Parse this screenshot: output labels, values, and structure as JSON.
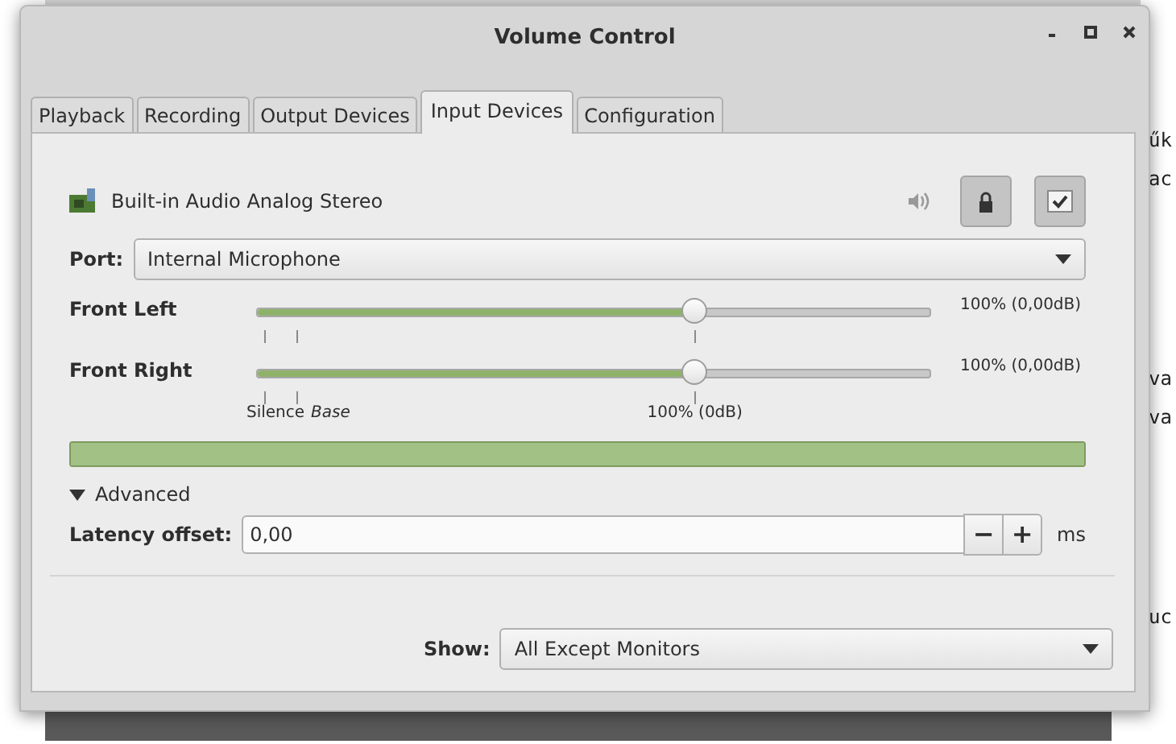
{
  "background_terminal": {
    "fragments": [
      "űk",
      "ac",
      "va",
      "va",
      "uc"
    ]
  },
  "window": {
    "title": "Volume Control"
  },
  "tabs": [
    {
      "label": "Playback",
      "selected": false
    },
    {
      "label": "Recording",
      "selected": false
    },
    {
      "label": "Output Devices",
      "selected": false
    },
    {
      "label": "Input Devices",
      "selected": true
    },
    {
      "label": "Configuration",
      "selected": false
    }
  ],
  "device": {
    "name": "Built-in Audio Analog Stereo",
    "lock": {
      "selected": true
    },
    "default": {
      "selected": true
    },
    "port": {
      "label": "Port:",
      "value": "Internal Microphone"
    },
    "channels": [
      {
        "name": "Front Left",
        "level": 0.65,
        "reading": "100% (0,00dB)"
      },
      {
        "name": "Front Right",
        "level": 0.65,
        "reading": "100% (0,00dB)"
      }
    ],
    "scale_marks": [
      {
        "label": "Silence",
        "italic": false
      },
      {
        "label": "Base",
        "italic": true
      },
      {
        "label": "100% (0dB)",
        "italic": false
      }
    ],
    "peak_meter": {
      "level": 1
    },
    "advanced": {
      "label": "Advanced",
      "expanded": true
    },
    "latency": {
      "label": "Latency offset:",
      "value": "0,00",
      "decrease": "−",
      "increase": "+",
      "unit": "ms"
    }
  },
  "show": {
    "label": "Show:",
    "value": "All Except Monitors"
  }
}
